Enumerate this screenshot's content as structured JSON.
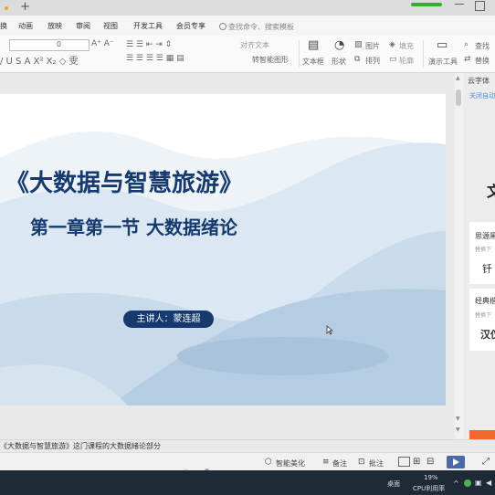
{
  "menu": {
    "items": [
      "换",
      "动画",
      "放映",
      "审阅",
      "视图",
      "开发工具",
      "会员专享"
    ],
    "search_placeholder": "查找命令、搜索模板"
  },
  "ribbon": {
    "font_size": "0",
    "buttons": {
      "align_text": "对齐文本",
      "convert_smartart": "转智能图形",
      "textbox": "文本框",
      "shape": "形状",
      "picture": "图片",
      "fill": "填充",
      "arrange": "排列",
      "outline": "轮廓",
      "present_tools": "演示工具",
      "find": "查找",
      "replace": "替换"
    }
  },
  "slide": {
    "title": "《大数据与智慧旅游》",
    "subtitle": "第一章第一节  大数据绪论",
    "presenter": "主讲人：蒙连超"
  },
  "right_panel": {
    "font": "云字体",
    "link": "关闭自动",
    "big_char": "文",
    "card1": {
      "title": "思源黑",
      "sub": "替换下",
      "body": "钎"
    },
    "card2": {
      "title": "经典楷",
      "sub": "替换下",
      "body": "汉仪"
    }
  },
  "notes": {
    "text": "《大数据与智慧旅游》这门课程的大数据绪论部分"
  },
  "status": {
    "beautify": "智能美化",
    "notes": "备注",
    "comment": "批注"
  },
  "taskbar": {
    "desktop": "桌面",
    "cpu_percent": "19%",
    "cpu_label": "CPU利用率"
  },
  "colors": {
    "title": "#163a6e",
    "badge": "#163a6e",
    "accent_orange": "#f26a2b",
    "wave_light": "#dbe7f2",
    "wave_mid": "#b5cde3"
  }
}
